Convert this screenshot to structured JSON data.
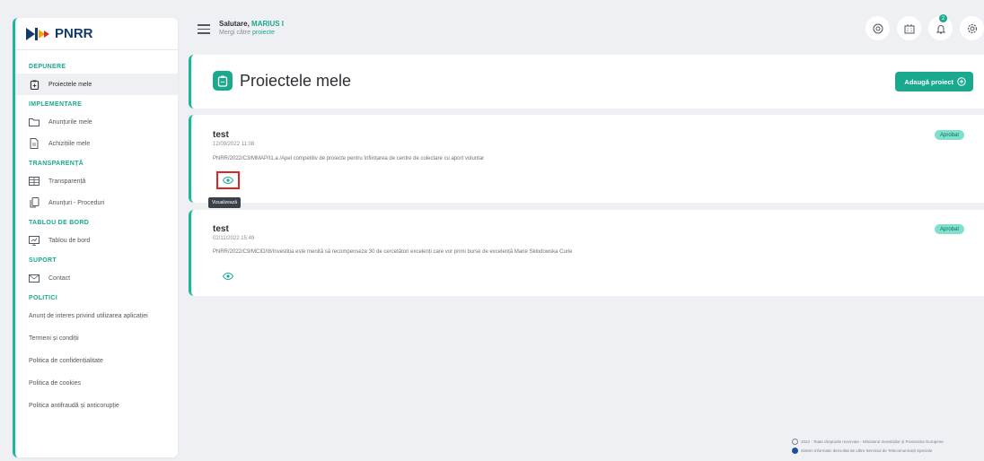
{
  "brand": {
    "name": "PNRR"
  },
  "greeting": {
    "prefix": "Salutare,",
    "user": "MARIUS I",
    "goto_prefix": "Mergi către",
    "goto_link": "proiecte"
  },
  "sidebar": {
    "sections": [
      {
        "title": "DEPUNERE",
        "items": [
          {
            "label": "Proiectele mele",
            "icon": "clipboard-icon",
            "active": true
          }
        ]
      },
      {
        "title": "IMPLEMENTARE",
        "items": [
          {
            "label": "Anunțurile mele",
            "icon": "folder-icon"
          },
          {
            "label": "Achizițiile mele",
            "icon": "document-icon"
          }
        ]
      },
      {
        "title": "TRANSPARENȚĂ",
        "items": [
          {
            "label": "Transparență",
            "icon": "table-icon"
          },
          {
            "label": "Anunțuri - Proceduri",
            "icon": "copy-icon"
          }
        ]
      },
      {
        "title": "TABLOU DE BORD",
        "items": [
          {
            "label": "Tablou de bord",
            "icon": "dashboard-icon"
          }
        ]
      },
      {
        "title": "SUPORT",
        "items": [
          {
            "label": "Contact",
            "icon": "mail-icon"
          }
        ]
      }
    ],
    "policies_title": "POLITICI",
    "policies": [
      "Anunț de interes privind utilizarea aplicației",
      "Termeni și condiții",
      "Politica de confidențialitate",
      "Politica de cookies",
      "Politica antifraudă și anticorupție"
    ]
  },
  "page": {
    "title": "Proiectele mele",
    "add_button": "Adaugă proiect"
  },
  "projects": [
    {
      "name": "test",
      "date": "12/09/2022 11:08",
      "description": "PNRR/2022/C3/MMAP/I1.a /Apel competitiv de proiecte pentru înființarea de centre de colectare cu aport voluntar",
      "status": "Aprobat"
    },
    {
      "name": "test",
      "date": "02/11/2022 15:49",
      "description": "PNRR/2022/C9/MCID/I8/Investiția este menită să recompenseze 30 de cercetători excelenți care vor primi burse de excelență Marie Skłodowska Curie",
      "status": "Aprobat"
    }
  ],
  "tooltip": "Vizualizează",
  "footer": {
    "copyright": "2022 - Toate drepturile rezervate - Ministerul Investițiilor și Proiectelor Europene",
    "system": "Sistem informatic dezvoltat de către Serviciul de Telecomunicații Speciale"
  },
  "colors": {
    "accent": "#1aa88e",
    "highlight": "#e02424"
  }
}
